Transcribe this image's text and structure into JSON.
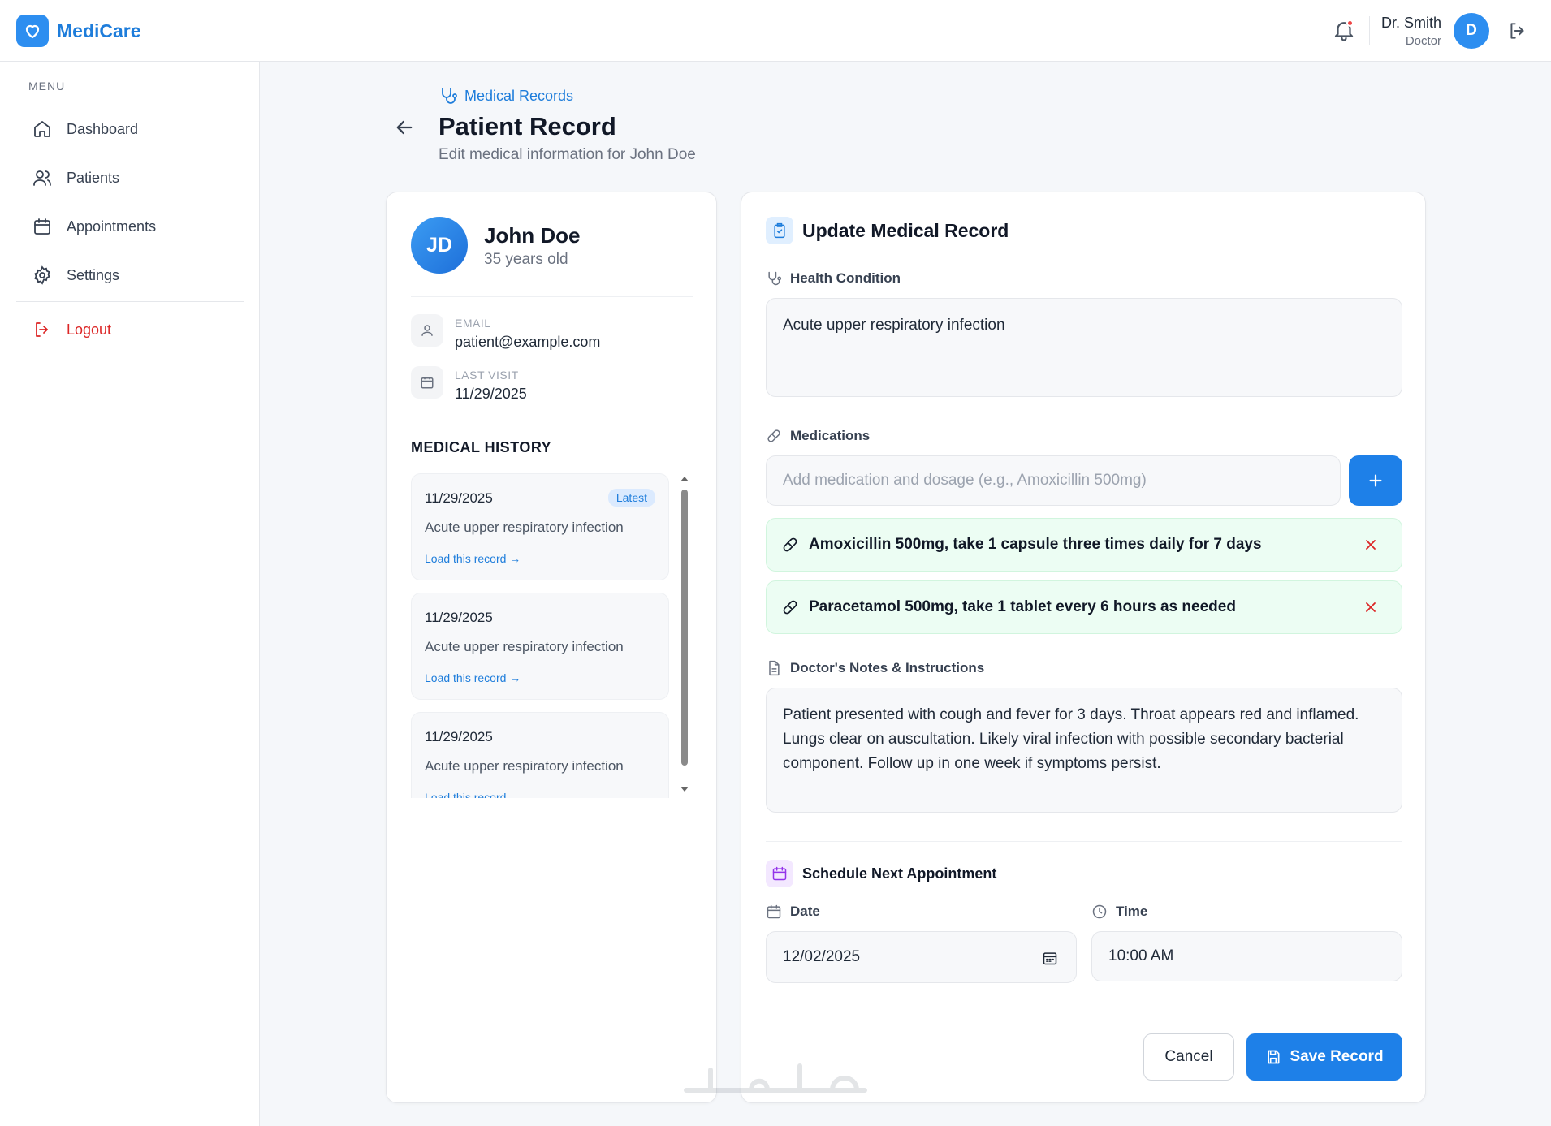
{
  "app": {
    "name": "MediCare"
  },
  "user": {
    "name": "Dr. Smith",
    "role": "Doctor",
    "initial": "D"
  },
  "sidebar": {
    "menu_label": "MENU",
    "items": [
      {
        "label": "Dashboard",
        "icon": "home-icon"
      },
      {
        "label": "Patients",
        "icon": "users-icon"
      },
      {
        "label": "Appointments",
        "icon": "calendar-icon"
      },
      {
        "label": "Settings",
        "icon": "gear-icon"
      }
    ],
    "logout_label": "Logout"
  },
  "page": {
    "breadcrumb": "Medical Records",
    "title": "Patient Record",
    "subtitle": "Edit medical information for John Doe"
  },
  "patient": {
    "initials": "JD",
    "name": "John Doe",
    "age": "35 years old",
    "email_label": "EMAIL",
    "email": "patient@example.com",
    "last_visit_label": "LAST VISIT",
    "last_visit": "11/29/2025"
  },
  "history": {
    "title": "MEDICAL HISTORY",
    "latest_badge": "Latest",
    "link_label": "Load this record →",
    "items": [
      {
        "date": "11/29/2025",
        "condition": "Acute upper respiratory infection"
      },
      {
        "date": "11/29/2025",
        "condition": "Acute upper respiratory infection"
      },
      {
        "date": "11/29/2025",
        "condition": "Acute upper respiratory infection"
      }
    ]
  },
  "form": {
    "title": "Update Medical Record",
    "condition_label": "Health Condition",
    "condition_value": "Acute upper respiratory infection",
    "medications_label": "Medications",
    "medication_placeholder": "Add medication and dosage (e.g., Amoxicillin 500mg)",
    "medications": [
      "Amoxicillin 500mg, take 1 capsule three times daily for 7 days",
      "Paracetamol 500mg, take 1 tablet every 6 hours as needed"
    ],
    "notes_label": "Doctor's Notes & Instructions",
    "notes_value": "Patient presented with cough and fever for 3 days. Throat appears red and inflamed. Lungs clear on auscultation. Likely viral infection with possible secondary bacterial component. Follow up in one week if symptoms persist.",
    "schedule_title": "Schedule Next Appointment",
    "date_label": "Date",
    "date_value": "12/02/2025",
    "time_label": "Time",
    "time_value": "10:00 AM",
    "cancel_label": "Cancel",
    "save_label": "Save Record"
  },
  "colors": {
    "primary": "#1e80e8",
    "danger": "#dc2626",
    "success_bg": "#ecfdf3"
  }
}
